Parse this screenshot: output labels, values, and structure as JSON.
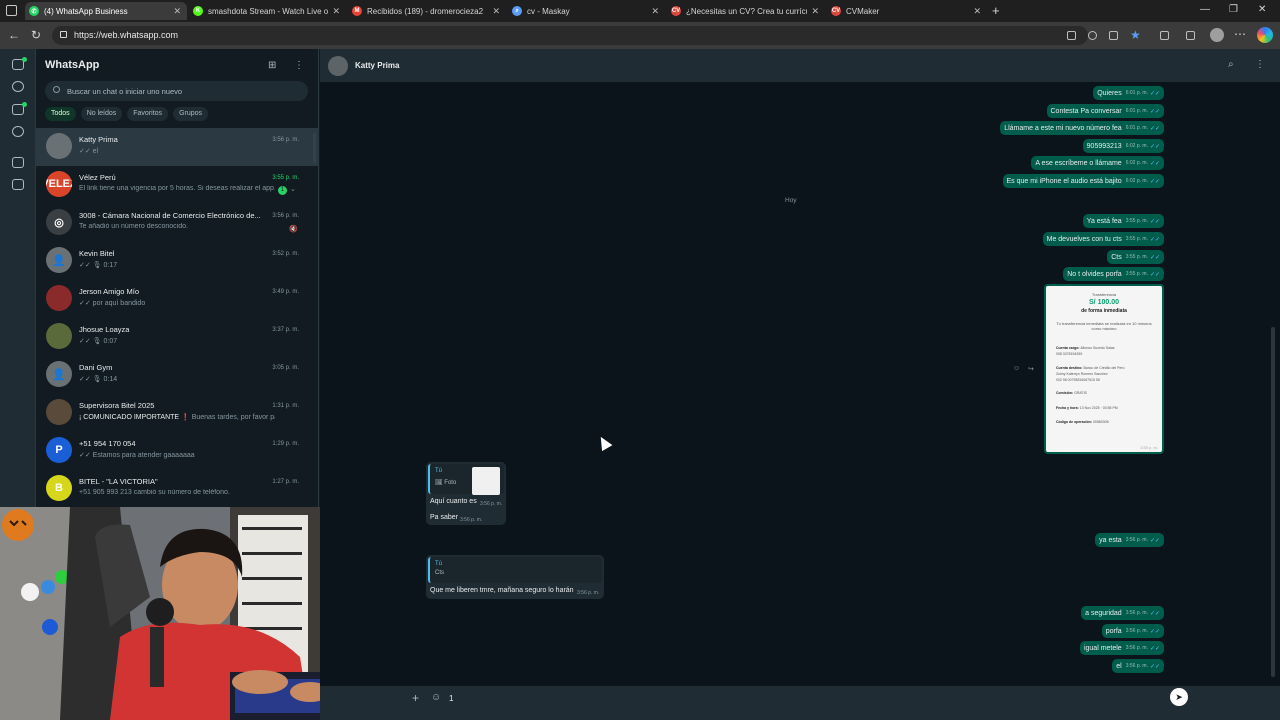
{
  "browser": {
    "tabs": [
      {
        "title": "(4) WhatsApp Business",
        "favicon": "whatsapp-icon",
        "color": "#25d366",
        "glyph": "✆"
      },
      {
        "title": "smashdota Stream - Watch Live o",
        "favicon": "kick-icon",
        "color": "#53fc18",
        "glyph": "K"
      },
      {
        "title": "Recibidos (189) - dromerocieza2",
        "favicon": "gmail-icon",
        "color": "#ea4335",
        "glyph": "M"
      },
      {
        "title": "cv - Maskay",
        "favicon": "search-icon",
        "color": "#5b9cf5",
        "glyph": "⌕"
      },
      {
        "title": "¿Necesitas un CV? Crea tu currícu",
        "favicon": "cvmaker-icon",
        "color": "#e0453b",
        "glyph": "CV"
      },
      {
        "title": "CVMaker",
        "favicon": "cvmaker-icon",
        "color": "#e0453b",
        "glyph": "CV"
      }
    ],
    "url": "https://web.whatsapp.com"
  },
  "sidebar": {
    "title": "WhatsApp",
    "search_placeholder": "Buscar un chat o iniciar uno nuevo",
    "filters": [
      "Todos",
      "No leídos",
      "Favoritos",
      "Grupos"
    ],
    "chats": [
      {
        "name": "Katty Prima",
        "preview": "✓✓ el",
        "time": "3:56 p. m.",
        "avatar_color": "#6a7175",
        "avatar_text": ""
      },
      {
        "name": "Vélez Perú",
        "preview": "El link tiene una vigencia por 5 horas. Si deseas realizar el app...",
        "time": "3:55 p. m.",
        "avatar_color": "#d9452b",
        "avatar_text": "VELEZ",
        "unread": "1",
        "time_green": true
      },
      {
        "name": "3008 - Cámara Nacional de Comercio Electrónico de...",
        "preview": "Te añadió un número desconocido.",
        "time": "3:56 p. m.",
        "avatar_color": "#3a3f44",
        "avatar_text": "◎",
        "muted": true
      },
      {
        "name": "Kevin Bitel",
        "preview": "✓✓ 🎙 0:17",
        "time": "3:52 p. m.",
        "avatar_color": "#6a7175",
        "avatar_text": "👤"
      },
      {
        "name": "Jerson Amigo Mío",
        "preview": "✓✓ por aquí bandido",
        "time": "3:49 p. m.",
        "avatar_color": "#8a2a2a",
        "avatar_text": ""
      },
      {
        "name": "Jhosue Loayza",
        "preview": "✓✓ 🎙 0:07",
        "time": "3:37 p. m.",
        "avatar_color": "#5a6a3a",
        "avatar_text": ""
      },
      {
        "name": "Dani Gym",
        "preview": "✓✓ 🎙 0:14",
        "time": "3:05 p. m.",
        "avatar_color": "#6a7175",
        "avatar_text": "👤"
      },
      {
        "name": "Supervisora Bitel 2025",
        "preview_parts": [
          "¡ COMUNICADO IMPORTANTE ",
          "❗",
          " Buenas tardes, por favor para co..."
        ],
        "time": "1:31 p. m.",
        "avatar_color": "#5a4a3a",
        "avatar_text": ""
      },
      {
        "name": "+51 954 170 054",
        "preview": "✓✓ Estamos para atender gaaaaaaa",
        "time": "1:29 p. m.",
        "avatar_color": "#1a5fd6",
        "avatar_text": "P"
      },
      {
        "name": "BITEL - \"LA VICTORIA\"",
        "preview": "+51 905 993 213 cambió su número de teléfono.",
        "time": "1:27 p. m.",
        "avatar_color": "#d6d61a",
        "avatar_text": "B"
      }
    ]
  },
  "chat": {
    "contact_name": "Katty Prima",
    "date_separator": "Hoy",
    "outgoing_top": [
      {
        "text": "Quieres",
        "time": "6:01 p. m."
      },
      {
        "text": "Contesta Pa conversar",
        "time": "6:01 p. m."
      },
      {
        "text": "Llámame a este mi nuevo número fea",
        "time": "6:01 p. m."
      },
      {
        "text": "905993213",
        "time": "6:02 p. m."
      },
      {
        "text": "A ese escríbeme o llámame",
        "time": "6:02 p. m."
      },
      {
        "text": "Es que mi iPhone el audio está bajito",
        "time": "6:02 p. m."
      }
    ],
    "outgoing_mid": [
      {
        "text": "Ya está fea",
        "time": "3:55 p. m."
      },
      {
        "text": "Me devuelves con tu cts",
        "time": "3:55 p. m."
      },
      {
        "text": "Cts",
        "time": "3:55 p. m."
      },
      {
        "text": "No t olvides porfa",
        "time": "3:55 p. m."
      }
    ],
    "receipt": {
      "header": "Transferencia",
      "amount": "S/ 100.00",
      "title": "de forma inmediata",
      "note": "Tu transferencia inmediata se realizará en 10 minutos como máximo",
      "lines": [
        {
          "label": "Cuenta cargo:",
          "value": "Alfonso Sucedo Salas"
        },
        {
          "label": "",
          "value": "008 3378154539"
        },
        {
          "label": "Cuenta destino:",
          "value": "Banco de Crédito del Perú"
        },
        {
          "label": "",
          "value": "Zulmy Katerryn Romero Sanchez"
        },
        {
          "label": "",
          "value": "002 98 00798254067515 55"
        },
        {
          "label": "Comisión:",
          "value": "GRATIS"
        },
        {
          "label": "Fecha y hora:",
          "value": "13 Nov 2025 · 03:55 PM"
        },
        {
          "label": "Código de operación:",
          "value": "00580008"
        }
      ],
      "time": "3:55 p. m."
    },
    "incoming_1": {
      "quote_author": "Tú",
      "quote_label": "🖼 Foto",
      "lines": [
        {
          "text": "Aquí cuanto es",
          "time": "3:56 p. m."
        },
        {
          "text": "Pa saber",
          "time": "3:56 p. m."
        }
      ]
    },
    "incoming_2": {
      "quote_author": "Tú",
      "quote_label": "Cts",
      "text": "Que me liberen tmre, mañana seguro lo harán",
      "time": "3:56 p. m."
    },
    "outgoing_bottom": [
      {
        "text": "ya esta",
        "time": "3:56 p. m."
      },
      {
        "text": "a seguridad",
        "time": "3:56 p. m."
      },
      {
        "text": "porfa",
        "time": "3:56 p. m."
      },
      {
        "text": "igual metele",
        "time": "3:56 p. m."
      },
      {
        "text": "el",
        "time": "3:56 p. m."
      }
    ],
    "composer_value": "1"
  },
  "colors": {
    "outgoing": "#005c4b",
    "incoming": "#202c33",
    "accent": "#25d366",
    "background": "#0b141a"
  }
}
